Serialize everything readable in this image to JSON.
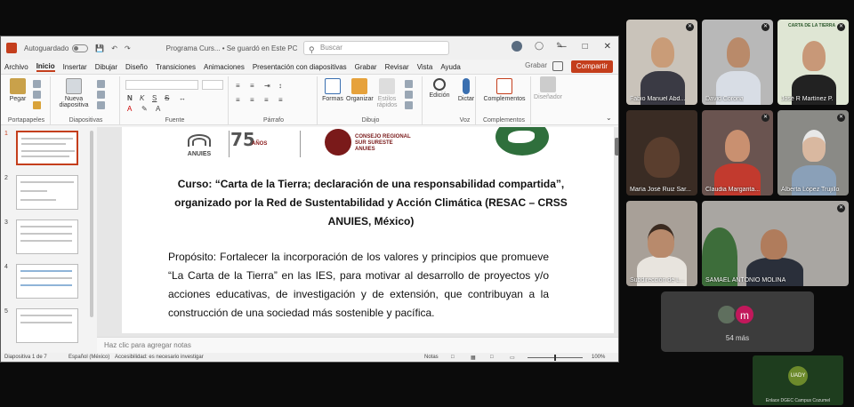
{
  "titlebar": {
    "autosave": "Autoguardado",
    "doc_title": "Programa Curs... • Se guardó en Este PC",
    "search_placeholder": "Buscar"
  },
  "menu": [
    "Archivo",
    "Inicio",
    "Insertar",
    "Dibujar",
    "Diseño",
    "Transiciones",
    "Animaciones",
    "Presentación con diapositivas",
    "Grabar",
    "Revisar",
    "Vista",
    "Ayuda"
  ],
  "menu_active": "Inicio",
  "grabar_label": "Grabar",
  "share_label": "Compartir",
  "ribbon": {
    "paste": "Pegar",
    "new_slide": "Nueva diapositiva",
    "shapes": "Formas",
    "arrange": "Organizar",
    "quick_styles": "Estilos rápidos",
    "edit": "Edición",
    "dictate": "Dictar",
    "addins": "Complementos",
    "designer": "Diseñador",
    "groups": [
      "Portapapeles",
      "Diapositivas",
      "Fuente",
      "Párrafo",
      "Dibujo",
      "Voz",
      "Complementos"
    ]
  },
  "slide": {
    "logo_anuies": "ANUIES",
    "logo_75": "75",
    "logo_75_sub": "AÑOS",
    "logo_crss": "CONSEJO REGIONAL\nSUR SURESTE\nANUIES",
    "course_text": "Curso: “Carta de la Tierra; declaración de una responsabilidad compartida”, organizado por la Red de Sustentabilidad y Acción Climática (RESAC – CRSS ANUIES, México)",
    "purpose_text": "Propósito: Fortalecer la incorporación de los valores y principios que promueve “La Carta de la Tierra” en las IES, para motivar al desarrollo de proyectos y/o acciones educativas, de investigación y de extensión, que contribuyan a la construcción de una sociedad más sostenible y pacífica."
  },
  "thumbs": [
    "1",
    "2",
    "3",
    "4",
    "5"
  ],
  "notes_placeholder": "Haz clic para agregar notas",
  "status": {
    "slide_of": "Diapositiva 1 de 7",
    "language": "Español (México)",
    "accessibility": "Accesibilidad: es necesario investigar",
    "notes": "Notas",
    "zoom": "100%"
  },
  "participants": [
    {
      "name": "Fabio Manuel Abd..."
    },
    {
      "name": "David Corona"
    },
    {
      "name": "José R Martínez P."
    },
    {
      "name": "María José Ruiz Sar..."
    },
    {
      "name": "Claudia Margarita..."
    },
    {
      "name": "Alberta López Trujillo"
    },
    {
      "name": "Subdirección de L..."
    },
    {
      "name": "SAMAEL ANTONIO MOLINA"
    }
  ],
  "tile_badge_carta": "CARTA DE LA TIERRA",
  "more": {
    "initial": "m",
    "count": "54 más"
  },
  "self": {
    "badge": "UADY",
    "name": "Enlace DGEC Campus Cozumel"
  }
}
